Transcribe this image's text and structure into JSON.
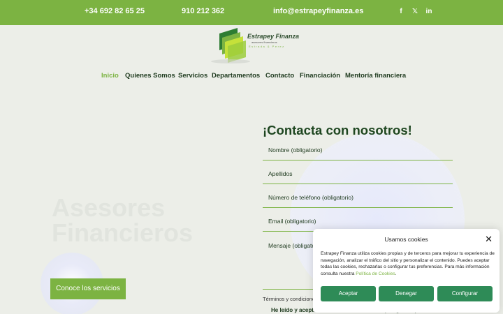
{
  "topbar": {
    "phone1": "+34 692 82 65 25",
    "phone2": "910 212 362",
    "email": "info@estrapeyfinanza.es",
    "social": [
      {
        "icon": "facebook-icon",
        "glyph": "f"
      },
      {
        "icon": "x-icon",
        "glyph": "𝕏"
      },
      {
        "icon": "linkedin-icon",
        "glyph": "in"
      }
    ]
  },
  "logo": {
    "name": "Estrapey Finanza",
    "tagline": "asesores financieros",
    "motto": "Estrada & Perez"
  },
  "nav": {
    "items": [
      {
        "label": "Inicio",
        "active": true
      },
      {
        "label": "Quienes Somos"
      },
      {
        "label": "Servicios"
      },
      {
        "label": "Departamentos"
      },
      {
        "label": "Contacto"
      },
      {
        "label": "Financiación"
      },
      {
        "label": "Mentoría financiera"
      }
    ]
  },
  "hero": {
    "faded_line1": "Asesores",
    "faded_line2": "Financieros",
    "cta_label": "Conoce los servicios"
  },
  "form": {
    "title": "¡Contacta con nosotros!",
    "name_label": "Nombre (obligatorio)",
    "surname_label": "Apellidos",
    "phone_label": "Número de teléfono (obligatorio)",
    "email_label": "Email (obligatorio)",
    "message_label": "Mensaje (obligatorio)",
    "terms_label": "Términos y condiciones",
    "privacy_label": "He leído y acepto la Política de Privacidad (obligatorio)"
  },
  "cookie": {
    "title": "Usamos cookies",
    "body": "Estrapey Finanza utiliza cookies propias y de terceros para mejorar tu experiencia de navegación, analizar el tráfico del sitio y personalizar el contenido. Puedes aceptar todas las cookies, rechazarlas o configurar tus preferencias. Para más información consulta nuestra ",
    "policy_link": "Política de Cookies",
    "accept_label": "Aceptar",
    "deny_label": "Denegar",
    "config_label": "Configurar"
  },
  "colors": {
    "brand_green": "#7cb342",
    "dark_green": "#1e4620",
    "button_green": "#2e8b57"
  }
}
